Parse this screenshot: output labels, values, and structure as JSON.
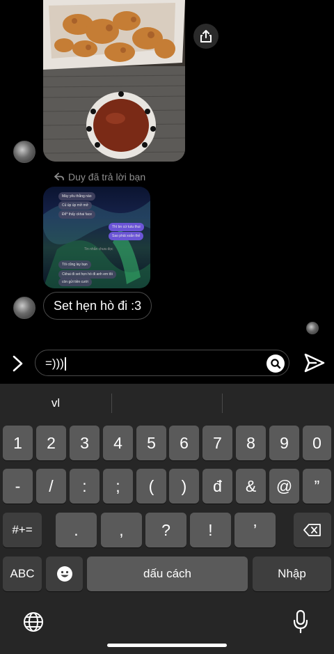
{
  "chat": {
    "reply_label": "Duy đã trả lời bạn",
    "message_text": "Set hẹn hò đi :3",
    "reply_thumbnail": {
      "messages": [
        {
          "text": "Mày yêu thằng nào",
          "mine": false
        },
        {
          "text": "Củ úp úp mở mở",
          "mine": false
        },
        {
          "text": "Để* thấy ckhai face",
          "mine": false
        },
        {
          "text": "Thì bn cứ tutu thui",
          "mine": true
        },
        {
          "text": "Sao phải xoắn thế",
          "mine": true
        },
        {
          "text": "Tin nhắn chưa đọc",
          "mine": false
        },
        {
          "text": "Tôi cũng lay bạn",
          "mine": false
        },
        {
          "text": "Ckhai đi set hẹn hò đi anh em tôi",
          "mine": false
        },
        {
          "text": "còn gửi tiền cưới",
          "mine": false
        }
      ]
    }
  },
  "composer": {
    "input_value": "=)))"
  },
  "keyboard": {
    "suggestions": [
      "vl",
      "",
      ""
    ],
    "row1": [
      "1",
      "2",
      "3",
      "4",
      "5",
      "6",
      "7",
      "8",
      "9",
      "0"
    ],
    "row2": [
      "-",
      "/",
      ":",
      ";",
      "(",
      ")",
      "đ",
      "&",
      "@",
      "”"
    ],
    "row3": [
      ".",
      ",",
      "?",
      "!",
      "’"
    ],
    "symbols_key": "#+=",
    "abc_key": "ABC",
    "space_label": "dấu cách",
    "return_label": "Nhập"
  },
  "icons": {
    "share": "share-icon",
    "reply": "reply-arrow-icon",
    "chevron": "chevron-right-icon",
    "search": "search-icon",
    "send": "send-icon",
    "delete": "backspace-icon",
    "emoji": "emoji-icon",
    "globe": "globe-icon",
    "mic": "microphone-icon"
  }
}
